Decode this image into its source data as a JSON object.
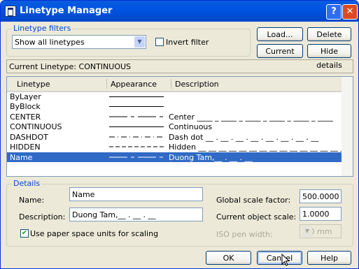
{
  "window": {
    "title": "Linetype Manager",
    "help_btn": "?",
    "close_btn": "✕"
  },
  "filters": {
    "group_label": "Linetype filters",
    "selected": "Show all linetypes",
    "invert_label": "Invert filter",
    "invert_checked": false
  },
  "buttons": {
    "load": "Load...",
    "delete": "Delete",
    "current": "Current",
    "hide_details": "Hide details",
    "ok": "OK",
    "cancel": "Cancel",
    "help": "Help"
  },
  "current_linetype": "Current Linetype:  CONTINUOUS",
  "list": {
    "columns": [
      "Linetype",
      "Appearance",
      "Description"
    ],
    "rows": [
      {
        "name": "ByLayer",
        "description": "",
        "pattern": "solid"
      },
      {
        "name": "ByBlock",
        "description": "",
        "pattern": "solid"
      },
      {
        "name": "CENTER",
        "description": "Center ____ _ ____ _ ____ _ ____ _ ____ _ ____",
        "pattern": "center"
      },
      {
        "name": "CONTINUOUS",
        "description": "Continuous",
        "pattern": "solid"
      },
      {
        "name": "DASHDOT",
        "description": "Dash dot __ . __ . __ . __ . __ . __ . __ . __",
        "pattern": "dashdot"
      },
      {
        "name": "HIDDEN",
        "description": "Hidden __ __ __ __ __ __ __ __ __ __ __ __ __ __ __",
        "pattern": "hidden"
      },
      {
        "name": "Name",
        "description": "Duong Tam,__ . __ . __",
        "pattern": "center",
        "selected": true
      }
    ]
  },
  "details": {
    "group_label": "Details",
    "name_label": "Name:",
    "name_value": "Name",
    "description_label": "Description:",
    "description_value": "Duong Tam,__ . __ . __",
    "paper_space_label": "Use paper space units for scaling",
    "paper_space_checked": true,
    "global_scale_label": "Global scale factor:",
    "global_scale_value": "500.0000",
    "object_scale_label": "Current object scale:",
    "object_scale_value": "1.0000",
    "iso_pen_label": "ISO pen width:",
    "iso_pen_value": "1.0 mm"
  }
}
